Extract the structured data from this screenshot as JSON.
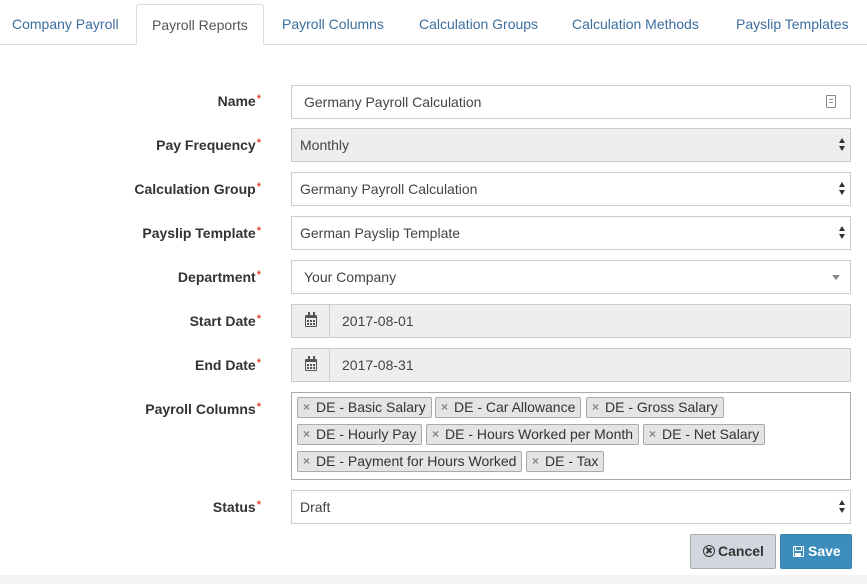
{
  "tabs": [
    {
      "label": "Company Payroll",
      "active": false
    },
    {
      "label": "Payroll Reports",
      "active": true
    },
    {
      "label": "Payroll Columns",
      "active": false
    },
    {
      "label": "Calculation Groups",
      "active": false
    },
    {
      "label": "Calculation Methods",
      "active": false
    },
    {
      "label": "Payslip Templates",
      "active": false
    }
  ],
  "form": {
    "required_mark": "*",
    "name": {
      "label": "Name",
      "value": "Germany Payroll Calculation",
      "icon": "contact-card-icon"
    },
    "pay_frequency": {
      "label": "Pay Frequency",
      "value": "Monthly"
    },
    "calculation_group": {
      "label": "Calculation Group",
      "value": "Germany Payroll Calculation"
    },
    "payslip_template": {
      "label": "Payslip Template",
      "value": "German Payslip Template"
    },
    "department": {
      "label": "Department",
      "value": "Your Company"
    },
    "start_date": {
      "label": "Start Date",
      "value": "2017-08-01",
      "icon": "calendar-icon"
    },
    "end_date": {
      "label": "End Date",
      "value": "2017-08-31",
      "icon": "calendar-icon"
    },
    "payroll_columns": {
      "label": "Payroll Columns",
      "remove_glyph": "×",
      "tags": [
        "DE - Basic Salary",
        "DE - Car Allowance",
        "DE - Gross Salary",
        "DE - Hourly Pay",
        "DE - Hours Worked per Month",
        "DE - Net Salary",
        "DE - Payment for Hours Worked",
        "DE - Tax"
      ]
    },
    "status": {
      "label": "Status",
      "value": "Draft"
    }
  },
  "buttons": {
    "cancel": {
      "label": "Cancel",
      "icon": "times-circle-icon"
    },
    "save": {
      "label": "Save",
      "icon": "floppy-disk-icon",
      "color": "#3c8dbc"
    }
  },
  "colors": {
    "link": "#3c6e9e",
    "required": "#dd4b39",
    "accent": "#3c8dbc"
  }
}
